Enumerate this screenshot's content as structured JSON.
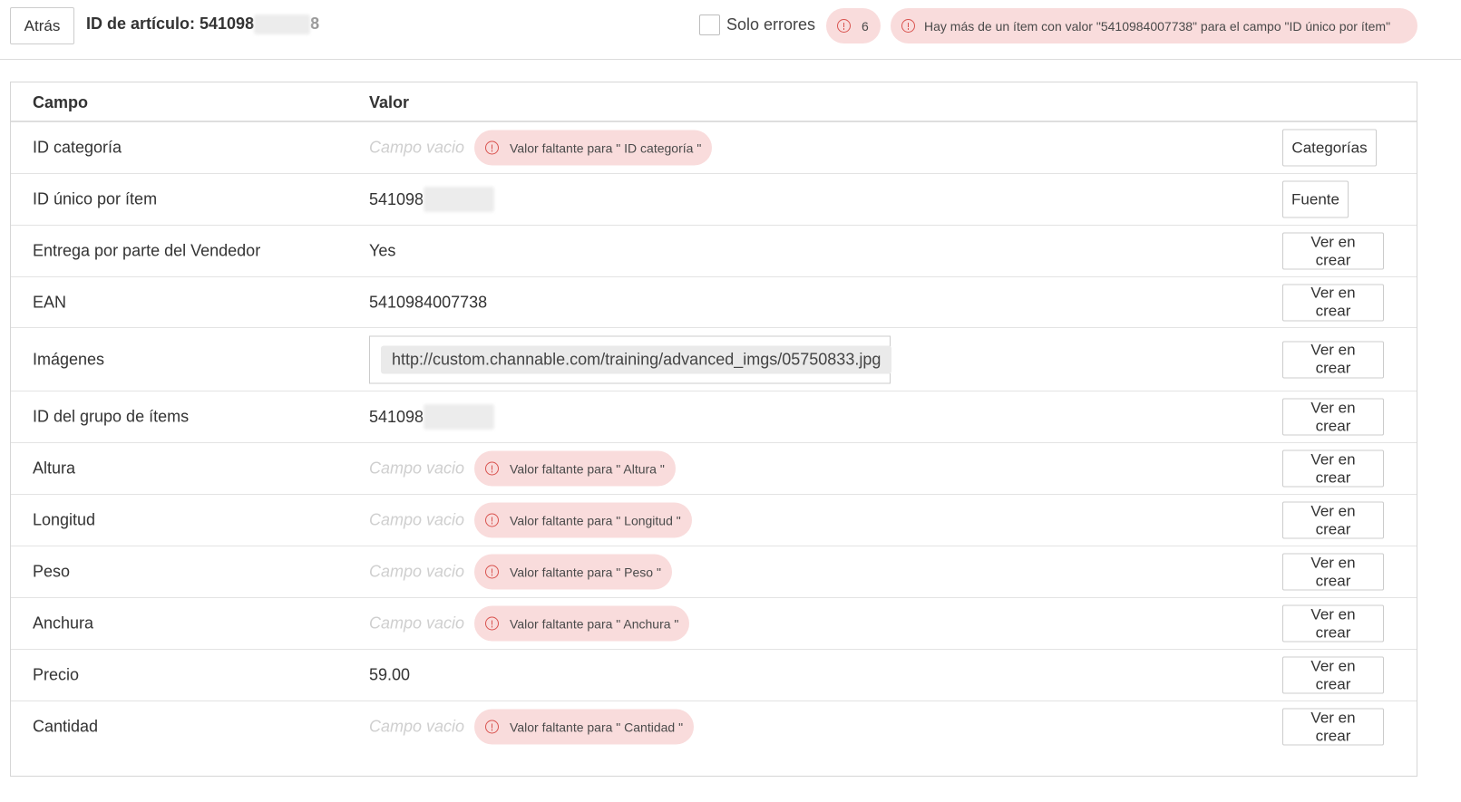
{
  "header": {
    "back_label": "Atrás",
    "article_id_label": "ID de artículo: 541098",
    "article_id_suffix": "8",
    "only_errors_label": "Solo errores",
    "error_count": "6",
    "top_error_message": "Hay más de un ítem con valor \"5410984007738\" para el campo \"ID único por ítem\""
  },
  "table": {
    "col_field": "Campo",
    "col_value": "Valor",
    "empty_placeholder": "Campo vacio",
    "rows": [
      {
        "field": "ID categoría",
        "value": "",
        "empty": true,
        "error": "Valor faltante para \" ID categoría \"",
        "button": "Categorías"
      },
      {
        "field": "ID único por ítem",
        "value": "541098",
        "blurred": true,
        "button": "Fuente"
      },
      {
        "field": "Entrega por parte del Vendedor",
        "value": "Yes",
        "button": "Ver en crear"
      },
      {
        "field": "EAN",
        "value": "5410984007738",
        "button": "Ver en crear"
      },
      {
        "field": "Imágenes",
        "value": "http://custom.channable.com/training/advanced_imgs/05750833.jpg",
        "image": true,
        "button": "Ver en crear"
      },
      {
        "field": "ID del grupo de ítems",
        "value": "541098",
        "blurred": true,
        "button": "Ver en crear"
      },
      {
        "field": "Altura",
        "value": "",
        "empty": true,
        "error": "Valor faltante para \" Altura \"",
        "button": "Ver en crear"
      },
      {
        "field": "Longitud",
        "value": "",
        "empty": true,
        "error": "Valor faltante para \" Longitud \"",
        "button": "Ver en crear"
      },
      {
        "field": "Peso",
        "value": "",
        "empty": true,
        "error": "Valor faltante para \" Peso \"",
        "button": "Ver en crear"
      },
      {
        "field": "Anchura",
        "value": "",
        "empty": true,
        "error": "Valor faltante para \" Anchura \"",
        "button": "Ver en crear"
      },
      {
        "field": "Precio",
        "value": "59.00",
        "button": "Ver en crear"
      },
      {
        "field": "Cantidad",
        "value": "",
        "empty": true,
        "error": "Valor faltante para \" Cantidad \"",
        "button": "Ver en crear"
      }
    ]
  },
  "colors": {
    "error_pill_bg": "#f9dcdc",
    "error_icon": "#d9534f",
    "empty_text": "#cfcfcf"
  }
}
